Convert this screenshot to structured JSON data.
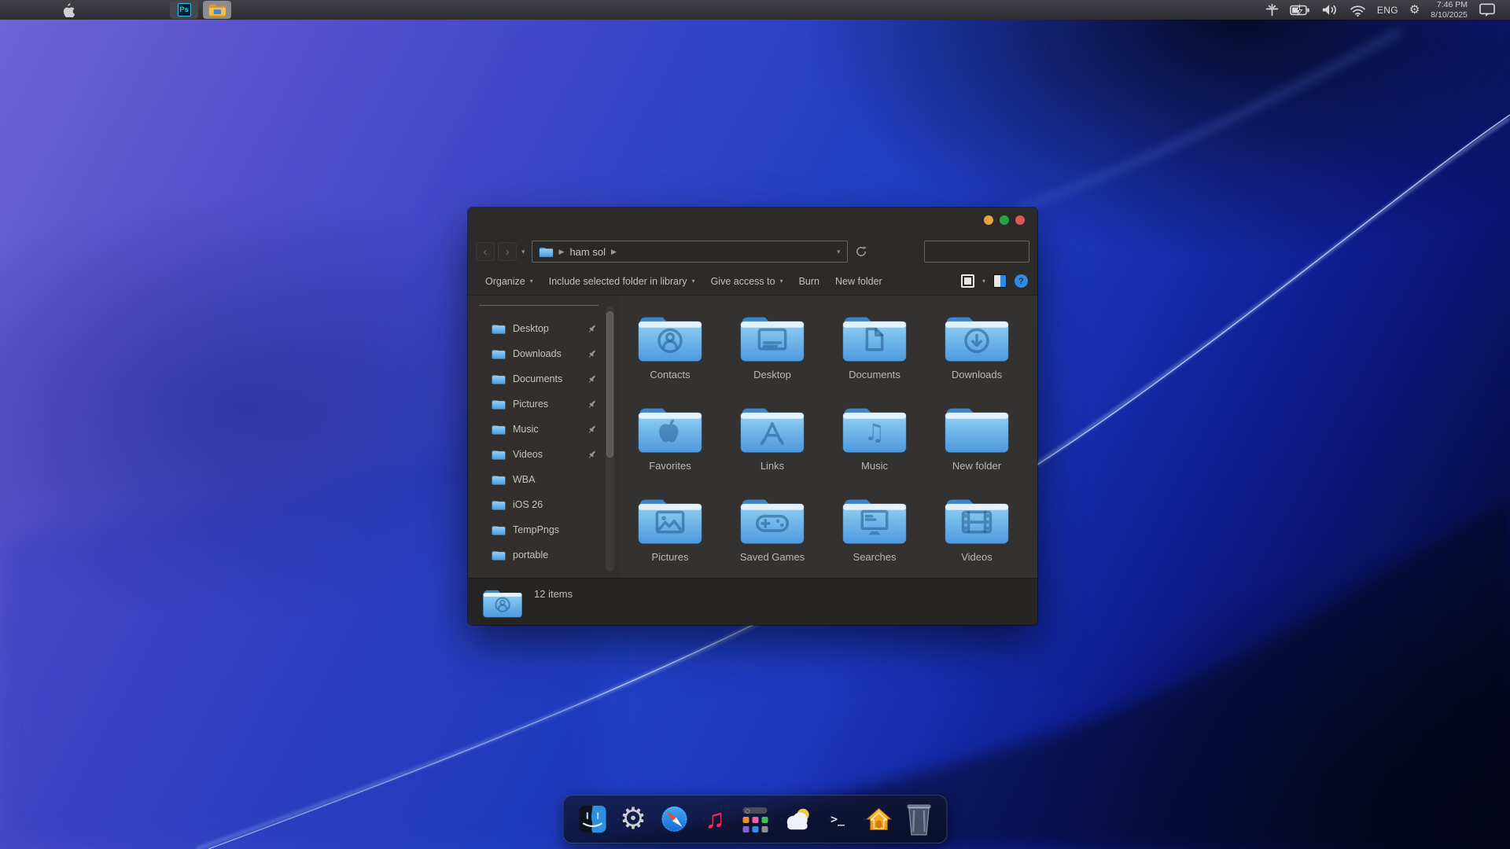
{
  "colors": {
    "accent_blue": "#2f8be0",
    "folder_blue_light": "#9ed7f8",
    "folder_blue_dark": "#4e9de2",
    "traffic_yellow": "#e6a33e",
    "traffic_green": "#23a342",
    "traffic_red": "#e25555"
  },
  "menu_bar": {
    "apple_menu_icon": "apple-logo",
    "apps": [
      {
        "id": "photoshop",
        "label": "Ps",
        "active": false
      },
      {
        "id": "file-explorer",
        "label": "",
        "active": true
      }
    ],
    "status": {
      "language": "ENG",
      "time": "7:46 PM",
      "date": "8/10/2025",
      "icons": [
        "hidden-items-icon",
        "battery-charging-icon",
        "volume-icon",
        "wifi-icon",
        "settings-gear-icon",
        "notifications-icon"
      ]
    }
  },
  "window": {
    "traffic_lights": [
      {
        "id": "minimize",
        "color": "#e6a33e"
      },
      {
        "id": "zoom",
        "color": "#23a342"
      },
      {
        "id": "close",
        "color": "#e25555"
      }
    ],
    "navigation": {
      "back": "‹",
      "forward": "›"
    },
    "address_bar": {
      "location": "ham sol"
    },
    "search_box": {
      "value": "",
      "placeholder": ""
    },
    "toolbar": {
      "buttons": [
        {
          "label": "Organize",
          "dropdown": true
        },
        {
          "label": "Include selected folder in library",
          "dropdown": true
        },
        {
          "label": "Give access to",
          "dropdown": true
        },
        {
          "label": "Burn",
          "dropdown": false
        },
        {
          "label": "New folder",
          "dropdown": false
        }
      ],
      "view_buttons": [
        "change-view",
        "preview-pane",
        "help"
      ]
    },
    "sidebar": {
      "items": [
        {
          "label": "Desktop",
          "pinned": true
        },
        {
          "label": "Downloads",
          "pinned": true
        },
        {
          "label": "Documents",
          "pinned": true
        },
        {
          "label": "Pictures",
          "pinned": true
        },
        {
          "label": "Music",
          "pinned": true
        },
        {
          "label": "Videos",
          "pinned": true
        },
        {
          "label": "WBA",
          "pinned": false
        },
        {
          "label": "iOS 26",
          "pinned": false
        },
        {
          "label": "TempPngs",
          "pinned": false
        },
        {
          "label": "portable",
          "pinned": false
        }
      ]
    },
    "folders": [
      {
        "label": "Contacts",
        "icon": "contacts"
      },
      {
        "label": "Desktop",
        "icon": "desktop"
      },
      {
        "label": "Documents",
        "icon": "documents"
      },
      {
        "label": "Downloads",
        "icon": "downloads"
      },
      {
        "label": "Favorites",
        "icon": "apple"
      },
      {
        "label": "Links",
        "icon": "appstore"
      },
      {
        "label": "Music",
        "icon": "music"
      },
      {
        "label": "New folder",
        "icon": "none"
      },
      {
        "label": "Pictures",
        "icon": "pictures"
      },
      {
        "label": "Saved Games",
        "icon": "gamepad"
      },
      {
        "label": "Searches",
        "icon": "monitor"
      },
      {
        "label": "Videos",
        "icon": "film"
      }
    ],
    "status_bar": {
      "items_count": "12 items",
      "selected_icon": "contacts-folder-icon"
    }
  },
  "dock": {
    "items": [
      {
        "id": "finder"
      },
      {
        "id": "settings"
      },
      {
        "id": "safari"
      },
      {
        "id": "music"
      },
      {
        "id": "launchpad"
      },
      {
        "id": "weather"
      },
      {
        "id": "terminal"
      },
      {
        "id": "home"
      },
      {
        "id": "trash"
      }
    ]
  }
}
